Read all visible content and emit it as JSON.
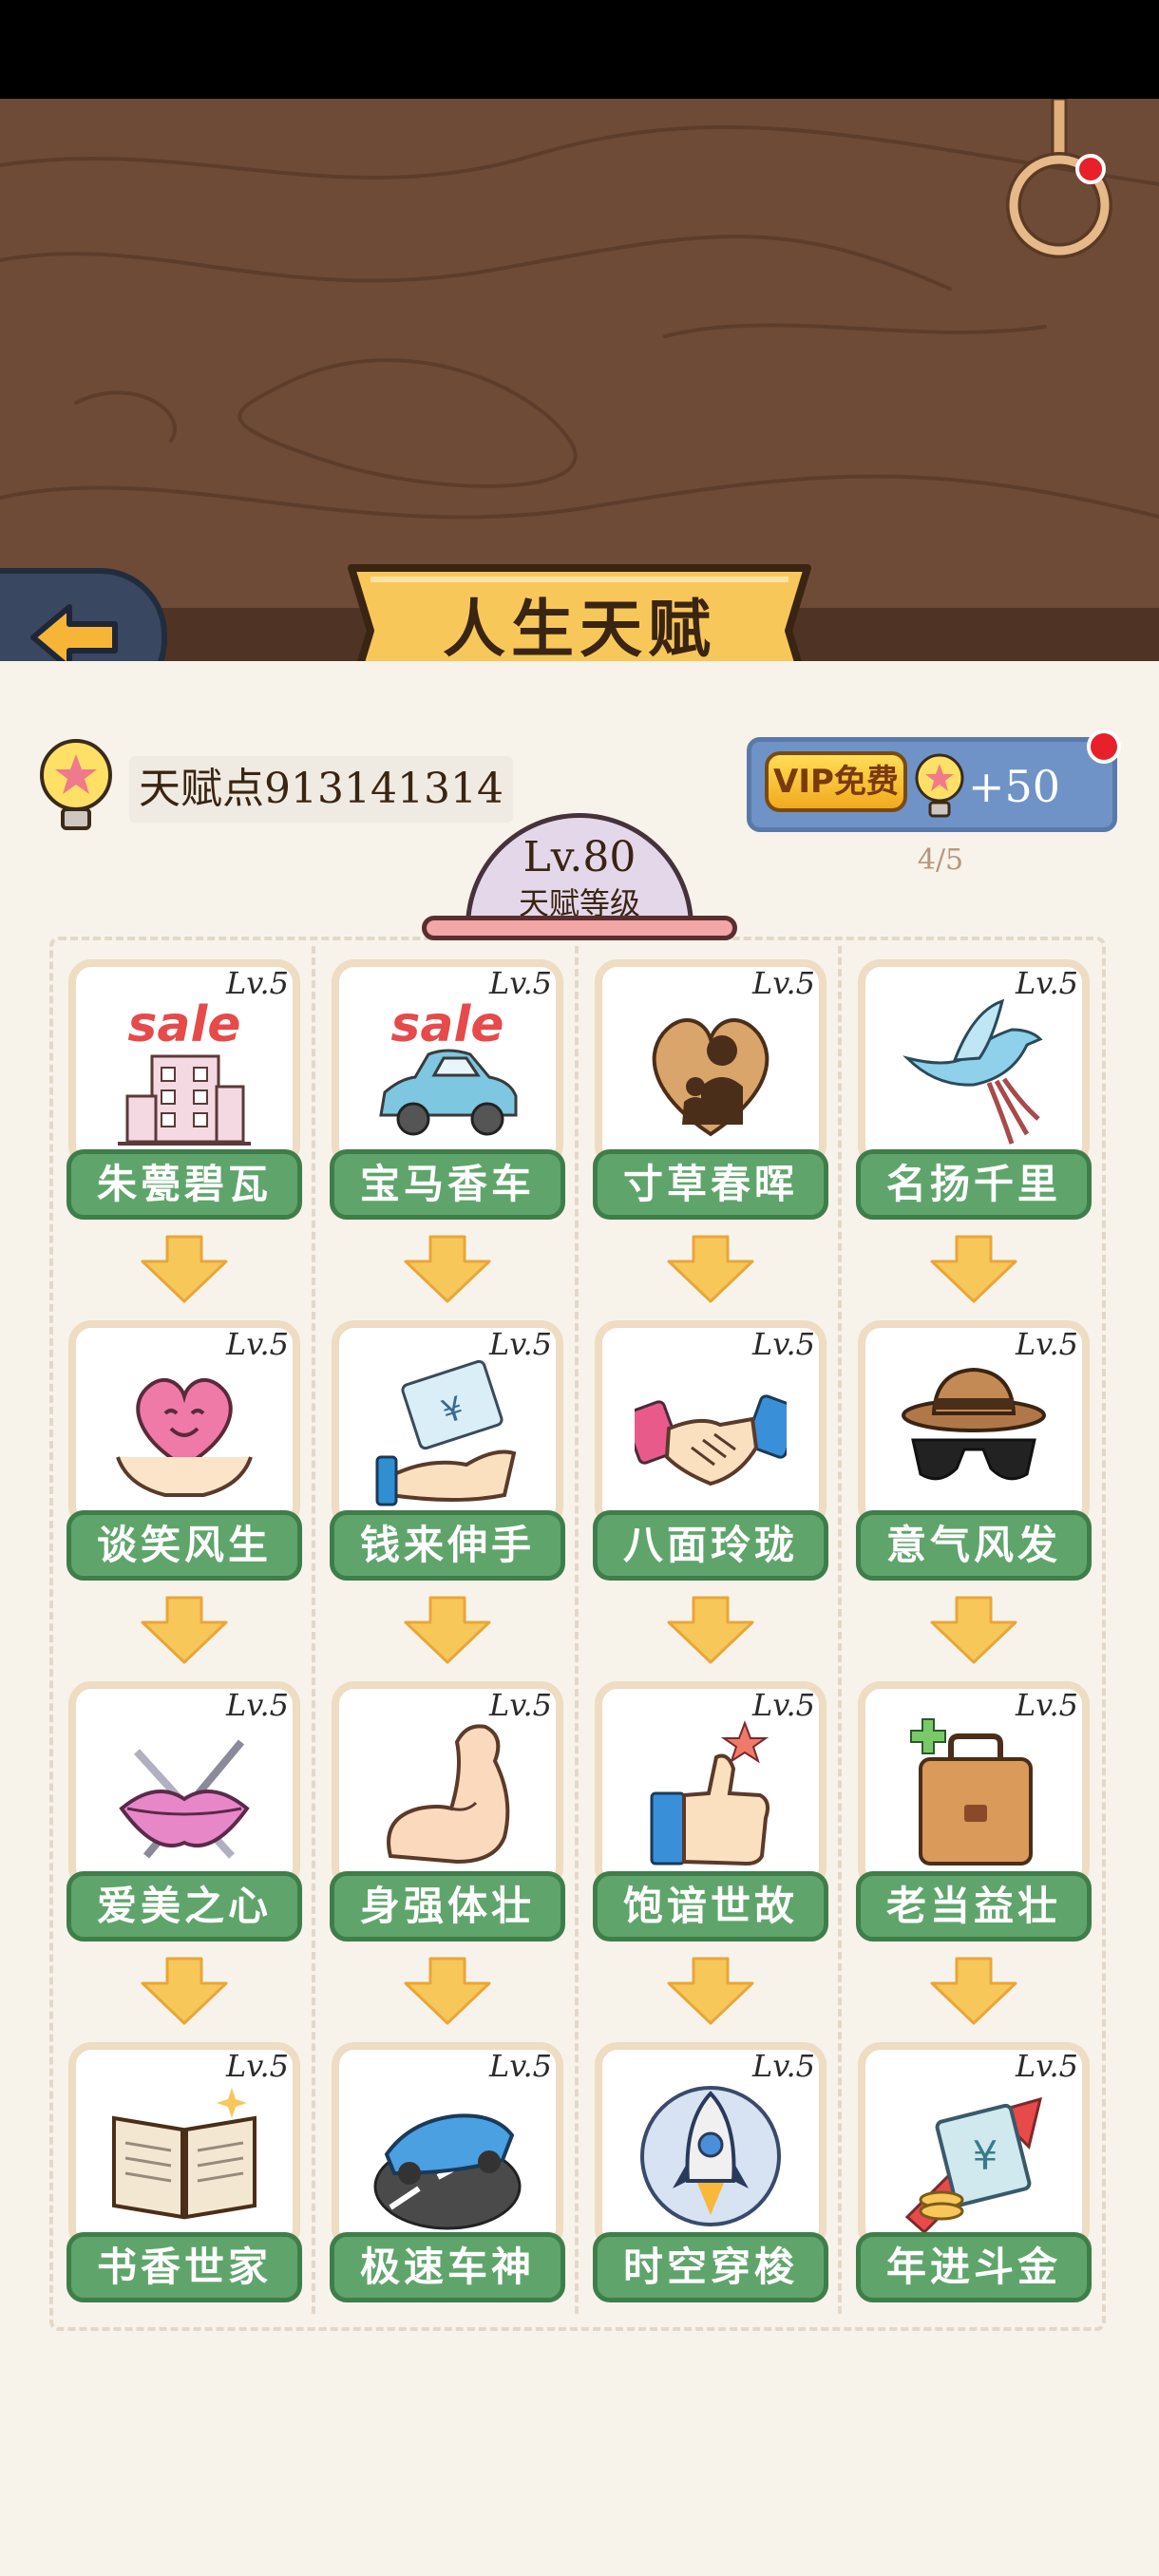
{
  "title": "人生天赋",
  "talent_points": "天赋点913141314",
  "vip": {
    "badge": "VIP免费",
    "amount": "+50",
    "count": "4/5"
  },
  "level": {
    "value": "Lv.80",
    "label": "天赋等级"
  },
  "cards": [
    {
      "lv": "Lv.5",
      "name": "朱甍碧瓦",
      "icon": "sale-building-icon"
    },
    {
      "lv": "Lv.5",
      "name": "宝马香车",
      "icon": "sale-car-icon"
    },
    {
      "lv": "Lv.5",
      "name": "寸草春晖",
      "icon": "heart-family-icon"
    },
    {
      "lv": "Lv.5",
      "name": "名扬千里",
      "icon": "flying-bird-icon"
    },
    {
      "lv": "Lv.5",
      "name": "谈笑风生",
      "icon": "smiling-heart-icon"
    },
    {
      "lv": "Lv.5",
      "name": "钱来伸手",
      "icon": "money-hand-icon"
    },
    {
      "lv": "Lv.5",
      "name": "八面玲珑",
      "icon": "handshake-icon"
    },
    {
      "lv": "Lv.5",
      "name": "意气风发",
      "icon": "hat-sunglasses-icon"
    },
    {
      "lv": "Lv.5",
      "name": "爱美之心",
      "icon": "lips-swords-icon"
    },
    {
      "lv": "Lv.5",
      "name": "身强体壮",
      "icon": "muscle-arm-icon"
    },
    {
      "lv": "Lv.5",
      "name": "饱谙世故",
      "icon": "thumbs-up-icon"
    },
    {
      "lv": "Lv.5",
      "name": "老当益壮",
      "icon": "briefcase-icon"
    },
    {
      "lv": "Lv.5",
      "name": "书香世家",
      "icon": "open-book-icon"
    },
    {
      "lv": "Lv.5",
      "name": "极速车神",
      "icon": "race-car-icon"
    },
    {
      "lv": "Lv.5",
      "name": "时空穿梭",
      "icon": "rocket-icon"
    },
    {
      "lv": "Lv.5",
      "name": "年进斗金",
      "icon": "money-arrow-icon"
    }
  ],
  "colors": {
    "wood": "#6e4b37",
    "banner": "#f8c75a",
    "card_label": "#5fa56b",
    "arrow": "#f8c75a",
    "vip_panel": "#6f93c7"
  }
}
